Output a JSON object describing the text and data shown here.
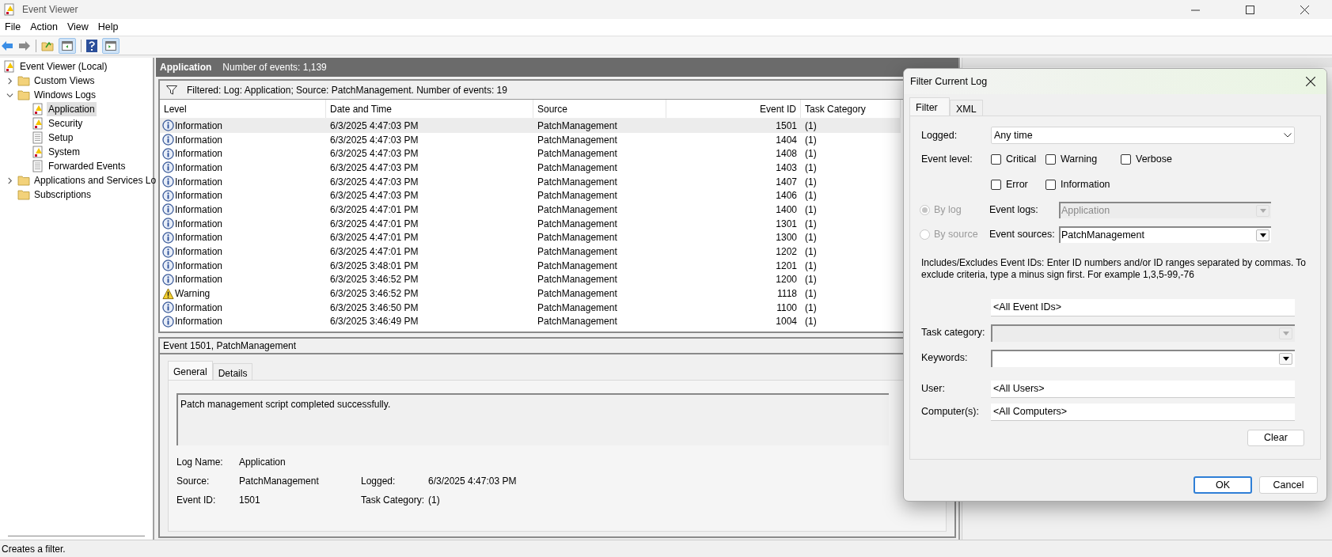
{
  "window": {
    "title": "Event Viewer"
  },
  "menu": [
    "File",
    "Action",
    "View",
    "Help"
  ],
  "tree": [
    {
      "label": "Event Viewer (Local)",
      "kind": "viewer",
      "children": [
        {
          "label": "Custom Views",
          "kind": "folder",
          "expanded": false,
          "selected": false
        },
        {
          "label": "Windows Logs",
          "kind": "folder",
          "expanded": true,
          "selected": false,
          "children": [
            {
              "label": "Application",
              "kind": "log",
              "selected": true
            },
            {
              "label": "Security",
              "kind": "log",
              "selected": false
            },
            {
              "label": "Setup",
              "kind": "plain",
              "selected": false
            },
            {
              "label": "System",
              "kind": "log",
              "selected": false
            },
            {
              "label": "Forwarded Events",
              "kind": "plain",
              "selected": false
            }
          ]
        },
        {
          "label": "Applications and Services Lo",
          "kind": "folder",
          "expanded": false,
          "selected": false
        },
        {
          "label": "Subscriptions",
          "kind": "folder",
          "selected": false
        }
      ],
      "selected": false
    }
  ],
  "log": {
    "title": "Application",
    "count": "Number of events: 1,139",
    "filter": "Filtered: Log: Application; Source: PatchManagement. Number of events: 19",
    "columns": [
      "Level",
      "Date and Time",
      "Source",
      "Event ID",
      "Task Category"
    ],
    "rows": [
      {
        "kind": "information",
        "level": "Information",
        "date": "6/3/2025 4:47:03 PM",
        "source": "PatchManagement",
        "event_id": "1501",
        "task_category": "(1)",
        "selected": true
      },
      {
        "kind": "information",
        "level": "Information",
        "date": "6/3/2025 4:47:03 PM",
        "source": "PatchManagement",
        "event_id": "1404",
        "task_category": "(1)",
        "selected": false
      },
      {
        "kind": "information",
        "level": "Information",
        "date": "6/3/2025 4:47:03 PM",
        "source": "PatchManagement",
        "event_id": "1408",
        "task_category": "(1)",
        "selected": false
      },
      {
        "kind": "information",
        "level": "Information",
        "date": "6/3/2025 4:47:03 PM",
        "source": "PatchManagement",
        "event_id": "1403",
        "task_category": "(1)",
        "selected": false
      },
      {
        "kind": "information",
        "level": "Information",
        "date": "6/3/2025 4:47:03 PM",
        "source": "PatchManagement",
        "event_id": "1407",
        "task_category": "(1)",
        "selected": false
      },
      {
        "kind": "information",
        "level": "Information",
        "date": "6/3/2025 4:47:03 PM",
        "source": "PatchManagement",
        "event_id": "1406",
        "task_category": "(1)",
        "selected": false
      },
      {
        "kind": "information",
        "level": "Information",
        "date": "6/3/2025 4:47:01 PM",
        "source": "PatchManagement",
        "event_id": "1400",
        "task_category": "(1)",
        "selected": false
      },
      {
        "kind": "information",
        "level": "Information",
        "date": "6/3/2025 4:47:01 PM",
        "source": "PatchManagement",
        "event_id": "1301",
        "task_category": "(1)",
        "selected": false
      },
      {
        "kind": "information",
        "level": "Information",
        "date": "6/3/2025 4:47:01 PM",
        "source": "PatchManagement",
        "event_id": "1300",
        "task_category": "(1)",
        "selected": false
      },
      {
        "kind": "information",
        "level": "Information",
        "date": "6/3/2025 4:47:01 PM",
        "source": "PatchManagement",
        "event_id": "1202",
        "task_category": "(1)",
        "selected": false
      },
      {
        "kind": "information",
        "level": "Information",
        "date": "6/3/2025 3:48:01 PM",
        "source": "PatchManagement",
        "event_id": "1201",
        "task_category": "(1)",
        "selected": false
      },
      {
        "kind": "information",
        "level": "Information",
        "date": "6/3/2025 3:46:52 PM",
        "source": "PatchManagement",
        "event_id": "1200",
        "task_category": "(1)",
        "selected": false
      },
      {
        "kind": "warning",
        "level": "Warning",
        "date": "6/3/2025 3:46:52 PM",
        "source": "PatchManagement",
        "event_id": "1118",
        "task_category": "(1)",
        "selected": false
      },
      {
        "kind": "information",
        "level": "Information",
        "date": "6/3/2025 3:46:50 PM",
        "source": "PatchManagement",
        "event_id": "1100",
        "task_category": "(1)",
        "selected": false
      },
      {
        "kind": "information",
        "level": "Information",
        "date": "6/3/2025 3:46:49 PM",
        "source": "PatchManagement",
        "event_id": "1004",
        "task_category": "(1)",
        "selected": false
      }
    ]
  },
  "event": {
    "title": "Event 1501, PatchManagement",
    "tabs": [
      {
        "label": "General",
        "selected": true
      },
      {
        "label": "Details",
        "selected": false
      }
    ],
    "message": "Patch management script completed successfully.",
    "fields": [
      [
        {
          "label": "Log Name:",
          "value": "Application"
        }
      ],
      [
        {
          "label": "Source:",
          "value": "PatchManagement"
        },
        {
          "label": "Logged:",
          "value": "6/3/2025 4:47:03 PM"
        }
      ],
      [
        {
          "label": "Event ID:",
          "value": "1501"
        },
        {
          "label": "Task Category:",
          "value": "(1)"
        }
      ]
    ]
  },
  "dialog": {
    "title": "Filter Current Log",
    "tabs": [
      {
        "label": "Filter",
        "selected": true
      },
      {
        "label": "XML",
        "selected": false
      }
    ],
    "logged": {
      "label": "Logged:",
      "value": "Any time"
    },
    "event_level": {
      "label": "Event level:",
      "options": [
        [
          {
            "label": "Critical",
            "checked": false
          },
          {
            "label": "Warning",
            "checked": false
          },
          {
            "label": "Verbose",
            "checked": false
          }
        ],
        [
          {
            "label": "Error",
            "checked": false
          },
          {
            "label": "Information",
            "checked": false
          }
        ]
      ]
    },
    "scope": [
      {
        "radio": "By log",
        "selected": true,
        "label": "Event logs:",
        "value": "Application",
        "disabled": true
      },
      {
        "radio": "By source",
        "selected": false,
        "label": "Event sources:",
        "value": "PatchManagement",
        "disabled": false
      }
    ],
    "hint": "Includes/Excludes Event IDs: Enter ID numbers and/or ID ranges separated by commas. To exclude criteria, type a minus sign first. For example 1,3,5-99,-76",
    "event_ids": "<All Event IDs>",
    "task_category": {
      "label": "Task category:",
      "disabled": true
    },
    "keywords": {
      "label": "Keywords:",
      "disabled": false
    },
    "user": {
      "label": "User:",
      "value": "<All Users>"
    },
    "computers": {
      "label": "Computer(s):",
      "value": "<All Computers>"
    },
    "clear": "Clear",
    "ok": "OK",
    "cancel": "Cancel"
  },
  "status_bar": "Creates a filter."
}
